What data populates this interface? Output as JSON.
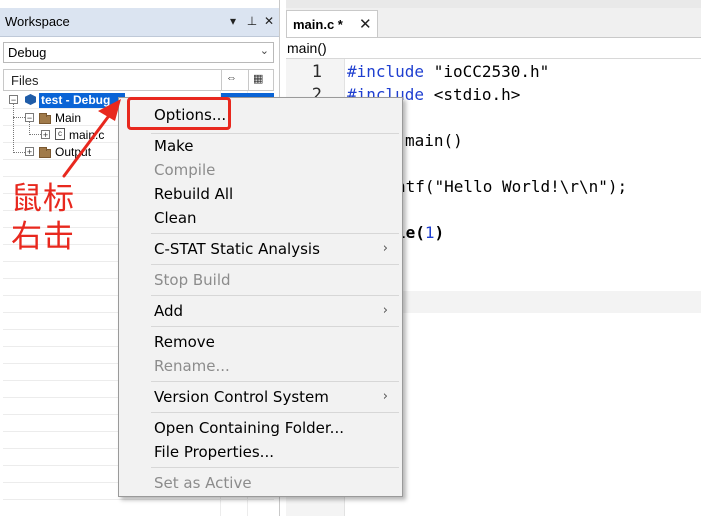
{
  "workspace": {
    "title": "Workspace",
    "dropdown_icon": "▾",
    "pin_icon": "⊥",
    "close_icon": "✕",
    "config": "Debug",
    "files_header": "Files",
    "tree": {
      "project": "test - Debug",
      "main_group": "Main",
      "main_file": "main.c",
      "output_group": "Output"
    }
  },
  "editor": {
    "tab_label": "main.c *",
    "tab_close": "✕",
    "function": "main()",
    "line_numbers": [
      "1",
      "2"
    ],
    "code": {
      "l1_kw": "#include",
      "l1_rest": " \"ioCC2530.h\"",
      "l2_kw": "#include",
      "l2_rest": " <stdio.h>",
      "l4_visible": "main()",
      "l6_visible": "ntf(\"Hello World!\\r\\n\");",
      "l8_visible_kw": "le",
      "l8_paren_open": "(",
      "l8_num": "1",
      "l8_paren_close": ")"
    }
  },
  "context_menu": {
    "options": "Options...",
    "make": "Make",
    "compile": "Compile",
    "rebuild_all": "Rebuild All",
    "clean": "Clean",
    "cstat": "C-STAT Static Analysis",
    "stop_build": "Stop Build",
    "add": "Add",
    "remove": "Remove",
    "rename": "Rename...",
    "vcs": "Version Control System",
    "open_folder": "Open Containing Folder...",
    "file_properties": "File Properties...",
    "set_active": "Set as Active",
    "submenu_arrow": "›"
  },
  "annotation": {
    "line1": "鼠标",
    "line2": "右击",
    "color": "#e8281e"
  }
}
